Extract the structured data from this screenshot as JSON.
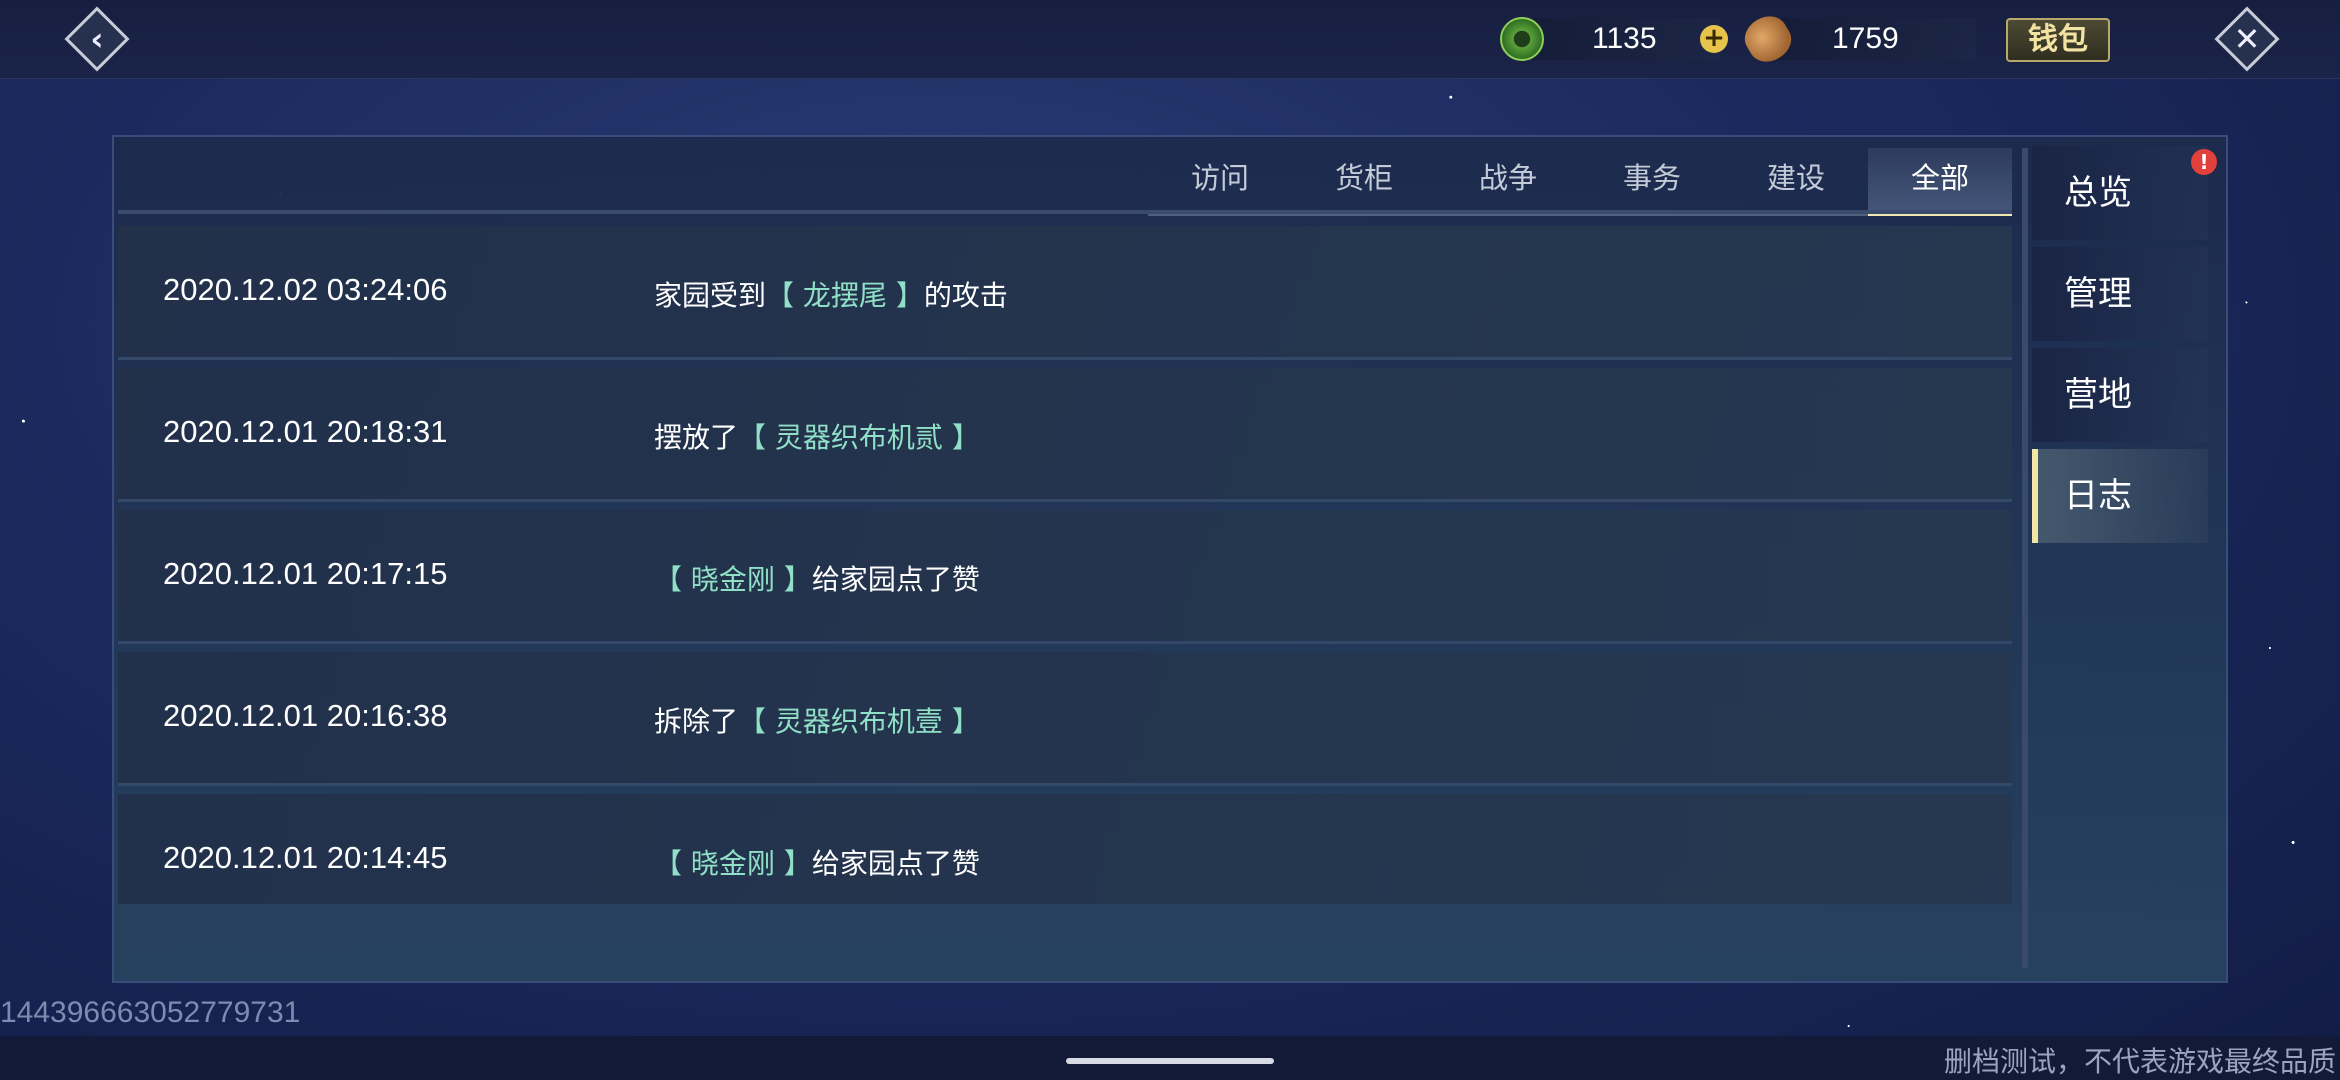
{
  "topbar": {
    "back_icon": "back-arrow-icon",
    "close_icon": "close-icon",
    "currencies": [
      {
        "icon": "jade-coin-icon",
        "value": "1135"
      },
      {
        "icon": "bread-icon",
        "value": "1759"
      }
    ],
    "add_label": "+",
    "wallet_label": "钱包"
  },
  "tabs": [
    {
      "label": "访问",
      "active": false
    },
    {
      "label": "货柜",
      "active": false
    },
    {
      "label": "战争",
      "active": false
    },
    {
      "label": "事务",
      "active": false
    },
    {
      "label": "建设",
      "active": false
    },
    {
      "label": "全部",
      "active": true
    }
  ],
  "side_tabs": [
    {
      "label": "总览",
      "active": false
    },
    {
      "label": "管理",
      "active": false
    },
    {
      "label": "营地",
      "active": false
    },
    {
      "label": "日志",
      "active": true
    }
  ],
  "alert": "!",
  "logs": [
    {
      "time": "2020.12.02 03:24:06",
      "pre": "家园受到",
      "hl": "【 龙摆尾 】",
      "post": "的攻击"
    },
    {
      "time": "2020.12.01 20:18:31",
      "pre": "摆放了",
      "hl": "【 灵器织布机贰 】",
      "post": ""
    },
    {
      "time": "2020.12.01 20:17:15",
      "pre": "",
      "hl": "【 晓金刚 】",
      "post": "给家园点了赞"
    },
    {
      "time": "2020.12.01 20:16:38",
      "pre": "拆除了",
      "hl": "【 灵器织布机壹 】",
      "post": ""
    },
    {
      "time": "2020.12.01 20:14:45",
      "pre": "",
      "hl": "【 晓金刚 】",
      "post": "给家园点了赞"
    }
  ],
  "footer": {
    "uid": "14439666305277973​1",
    "watermark": "删档测试，不代表游戏最终品质"
  },
  "colors": {
    "highlight": "#8fe0c6",
    "active_accent": "#f0e6a6"
  }
}
